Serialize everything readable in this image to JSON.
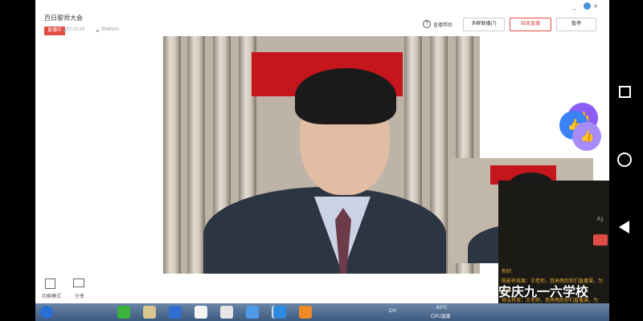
{
  "app": {
    "title": "百日誓师大会",
    "status_badge": "直播中",
    "duration": "00:10:29",
    "bitrate": "854Kb/s",
    "help_label": "直播帮助",
    "buttons": {
      "multi_stream": "多群联播(7)",
      "end_live": "结束直播",
      "pause": "暂停"
    }
  },
  "bottom_tools": [
    {
      "label": "切换模式",
      "icon": "grid-icon"
    },
    {
      "label": "分享",
      "icon": "share-screen-icon"
    }
  ],
  "chat": {
    "lines": [
      "你好:",
      "陈影有效果：王老师，我来雨后你们直播课，为",
      "你好:",
      "杨洁有效：王老师，我来雨后你们直播课，为",
      "你好:",
      "安庆九一中学…",
      "你好:"
    ],
    "partial_text": "人)"
  },
  "taskbar": {
    "lang": "CH",
    "temp": "62℃",
    "cpu_label": "CPU温度",
    "icons": [
      "start-orb-icon",
      "green-app-icon",
      "folder-icon",
      "wps-icon",
      "wechat-icon",
      "window-icon",
      "arrow-icon",
      "file-icon",
      "video-icon",
      "orange-app-icon"
    ]
  },
  "watermark": {
    "text": "安庆九一六学校"
  },
  "colors": {
    "accent_red": "#e04b43",
    "banner_red": "#c4161c",
    "like_purple": "#8b5cf6",
    "like_blue": "#3b82f6"
  }
}
